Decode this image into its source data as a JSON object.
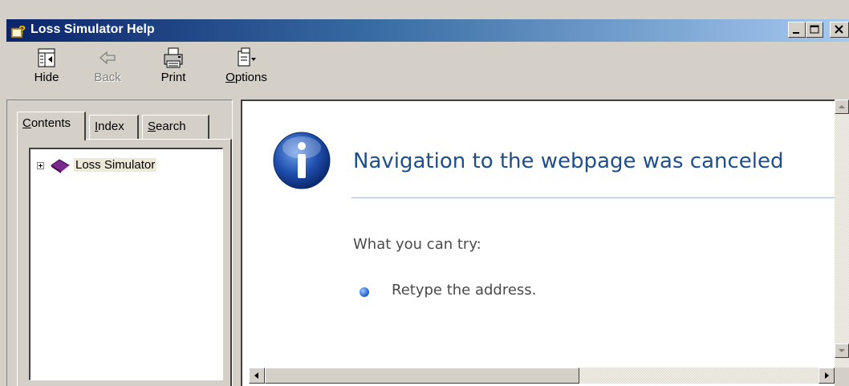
{
  "window": {
    "title": "Loss Simulator Help",
    "minimize_glyph": "_",
    "maximize_glyph": "□",
    "close_glyph": "×"
  },
  "toolbar": {
    "hide_label": "Hide",
    "back_label": "Back",
    "print_label": "Print",
    "options_label": "Options",
    "options_access_key": "O",
    "options_rest": "ptions"
  },
  "tabs": [
    {
      "label": "Contents",
      "access_key": "C",
      "rest": "ontents",
      "active": true
    },
    {
      "label": "Index",
      "access_key": "I",
      "rest": "ndex",
      "active": false
    },
    {
      "label": "Search",
      "access_key": "S",
      "rest": "earch",
      "active": false
    }
  ],
  "tree": {
    "items": [
      {
        "label": "Loss Simulator",
        "icon": "book-icon",
        "expanded": false
      }
    ]
  },
  "content": {
    "heading": "Navigation to the webpage was canceled",
    "subheading": "What you can try:",
    "suggestions": [
      "Retype the address."
    ]
  },
  "colors": {
    "titlebar_start": "#0a246a",
    "titlebar_end": "#a6caf0",
    "heading": "#1f4e8c",
    "chrome": "#d4d0c8"
  }
}
